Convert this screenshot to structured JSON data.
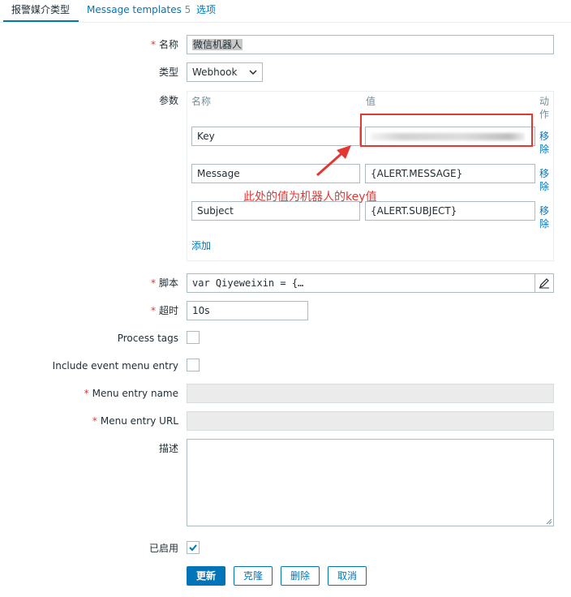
{
  "tabs": [
    {
      "label": "报警媒介类型"
    },
    {
      "label": "Message templates",
      "count": "5"
    },
    {
      "label": "选项"
    }
  ],
  "form": {
    "name_label": "名称",
    "name_value": "微信机器人",
    "type_label": "类型",
    "type_value": "Webhook",
    "params_label": "参数",
    "params": {
      "col_name": "名称",
      "col_value": "值",
      "col_action_1": "动",
      "col_action_2": "作",
      "rows": [
        {
          "name": "Key",
          "value": "",
          "action_1": "移",
          "action_2": "除"
        },
        {
          "name": "Message",
          "value": "{ALERT.MESSAGE}",
          "action_1": "移",
          "action_2": "除"
        },
        {
          "name": "Subject",
          "value": "{ALERT.SUBJECT}",
          "action_1": "移",
          "action_2": "除"
        }
      ],
      "add_label": "添加"
    },
    "script_label": "脚本",
    "script_value": "var Qiyeweixin = {…",
    "timeout_label": "超时",
    "timeout_value": "10s",
    "process_tags_label": "Process tags",
    "include_menu_label": "Include event menu entry",
    "menu_name_label": "Menu entry name",
    "menu_url_label": "Menu entry URL",
    "desc_label": "描述",
    "enabled_label": "已启用",
    "required_mark": "*"
  },
  "annotation": {
    "text": "此处的值为机器人的key值",
    "color": "#e33734"
  },
  "buttons": {
    "update": "更新",
    "clone": "克隆",
    "delete": "删除",
    "cancel": "取消"
  },
  "colors": {
    "accent": "#0275b8",
    "required": "#e33734"
  }
}
